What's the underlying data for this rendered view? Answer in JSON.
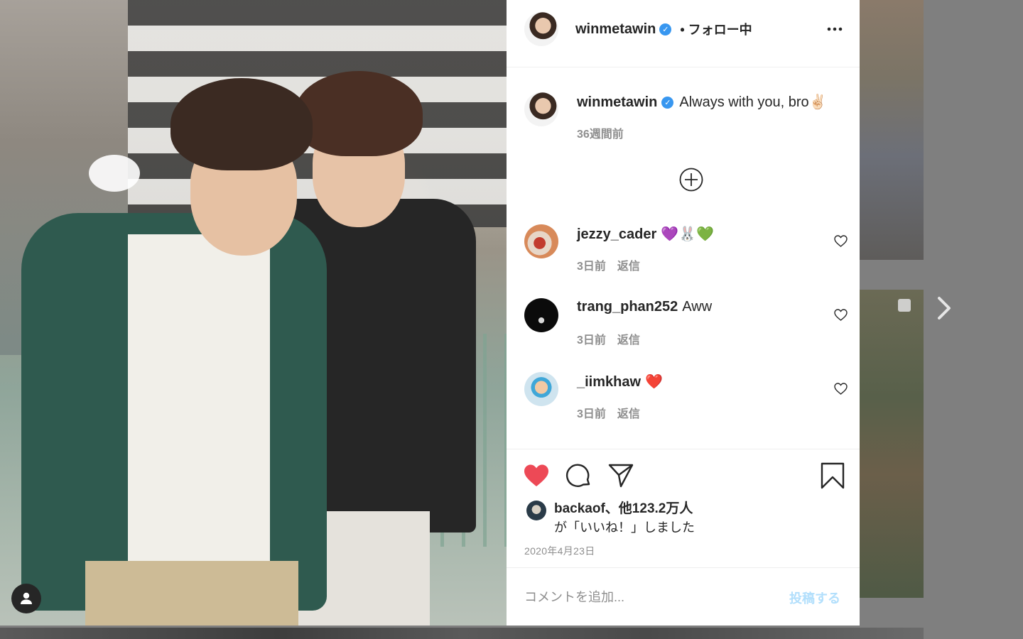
{
  "post": {
    "owner": {
      "username": "winmetawin",
      "follow_status": "• フォロー中"
    },
    "caption": {
      "username": "winmetawin",
      "text": "Always with you, bro✌🏻",
      "time": "36週間前"
    },
    "comments": [
      {
        "username": "jezzy_cader",
        "text": "💜🐰💚",
        "time": "3日前",
        "reply": "返信"
      },
      {
        "username": "trang_phan252",
        "text": "Aww",
        "time": "3日前",
        "reply": "返信"
      },
      {
        "username": "_iimkhaw",
        "text": "❤️",
        "time": "3日前",
        "reply": "返信"
      }
    ],
    "likes": {
      "line1": "backaof、他123.2万人",
      "line2": "が「いいね！」しました"
    },
    "date": "2020年4月23日",
    "comment_box": {
      "placeholder": "コメントを追加...",
      "post_label": "投稿する"
    },
    "liked": true
  },
  "icons": {
    "verified": "verified-badge-icon",
    "more": "more-options-icon",
    "load_more": "load-more-comments-icon",
    "like": "heart-icon",
    "comment": "comment-icon",
    "share": "share-icon",
    "save": "bookmark-icon",
    "next": "chevron-right-icon",
    "account": "user-account-icon"
  },
  "colors": {
    "like_active": "#ed4956",
    "verified": "#3897f0",
    "post_button_disabled": "#b2dffc"
  }
}
